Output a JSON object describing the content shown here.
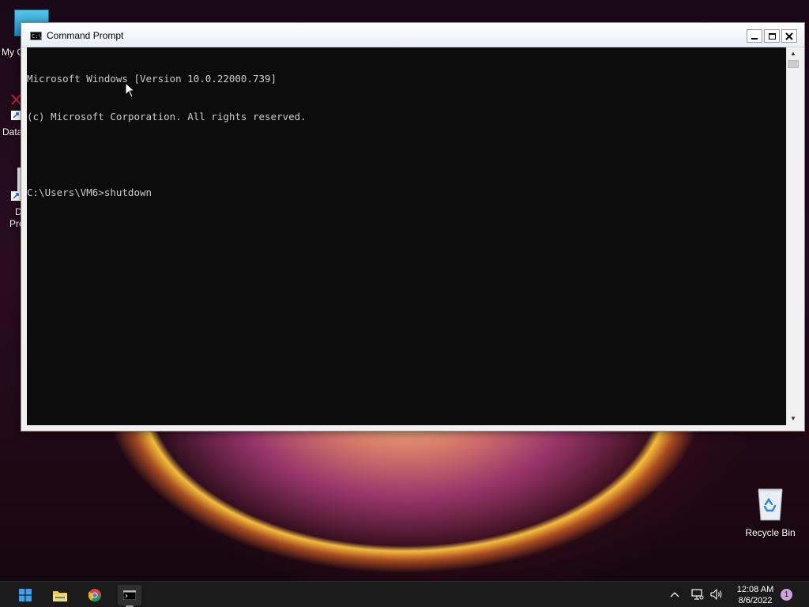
{
  "desktop": {
    "left_labels": [
      "My C",
      "Data",
      "D",
      "Pro"
    ],
    "recycle_bin": {
      "label": "Recycle Bin"
    }
  },
  "window": {
    "title": "Command Prompt",
    "controls": {
      "minimize": "minimize-icon",
      "maximize": "maximize-icon",
      "close": "close-icon"
    }
  },
  "console": {
    "lines": [
      "Microsoft Windows [Version 10.0.22000.739]",
      "(c) Microsoft Corporation. All rights reserved.",
      "",
      "C:\\Users\\VM6>shutdown"
    ]
  },
  "taskbar": {
    "pinned": [
      "windows-start-icon",
      "file-explorer-icon",
      "chrome-icon",
      "terminal-icon"
    ],
    "tray_icons": [
      "chevron-up-icon",
      "network-icon",
      "volume-icon"
    ],
    "clock": {
      "time": "12:08 AM",
      "date": "8/6/2022"
    },
    "notification_count": "1"
  },
  "colors": {
    "console_bg": "#0c0c0c",
    "console_fg": "#cccccc",
    "taskbar_bg": "#1b1b1b",
    "windows_blue": "#3aa0f0"
  }
}
